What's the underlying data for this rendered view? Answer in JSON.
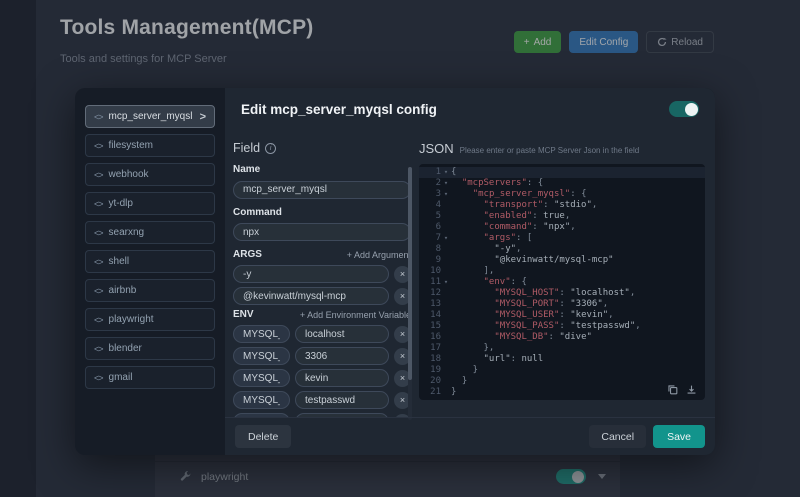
{
  "page": {
    "title": "Tools Management(MCP)",
    "subtitle": "Tools and settings for MCP Server",
    "actions": {
      "add": "Add",
      "edit_config": "Edit Config",
      "reload": "Reload"
    }
  },
  "background_tool_row": {
    "name": "playwright",
    "enabled": true
  },
  "modal": {
    "server_list": [
      {
        "label": "mcp_server_myqsl",
        "selected": true
      },
      {
        "label": "filesystem",
        "selected": false
      },
      {
        "label": "webhook",
        "selected": false
      },
      {
        "label": "yt-dlp",
        "selected": false
      },
      {
        "label": "searxng",
        "selected": false
      },
      {
        "label": "shell",
        "selected": false
      },
      {
        "label": "airbnb",
        "selected": false
      },
      {
        "label": "playwright",
        "selected": false
      },
      {
        "label": "blender",
        "selected": false
      },
      {
        "label": "gmail",
        "selected": false
      }
    ],
    "header": {
      "title": "Edit mcp_server_myqsl config",
      "enabled": true
    },
    "field_panel": {
      "title": "Field",
      "name_label": "Name",
      "name_value": "mcp_server_myqsl",
      "command_label": "Command",
      "command_value": "npx",
      "args_label": "ARGS",
      "add_argument_label": "+ Add Argument",
      "args": [
        "-y",
        "@kevinwatt/mysql-mcp"
      ],
      "env_label": "ENV",
      "add_env_label": "+ Add Environment Variable",
      "env": [
        {
          "key": "MYSQL_HOST",
          "value": "localhost"
        },
        {
          "key": "MYSQL_PORT",
          "value": "3306"
        },
        {
          "key": "MYSQL_USER",
          "value": "kevin"
        },
        {
          "key": "MYSQL_PASS",
          "value": "testpasswd"
        },
        {
          "key": "MYSQL_DB",
          "value": "dive"
        }
      ]
    },
    "json_panel": {
      "title": "JSON",
      "hint": "Please enter or paste MCP Server Json in the field",
      "code_lines": [
        {
          "n": 1,
          "fold": true,
          "parts": [
            [
              "{",
              "pln"
            ]
          ]
        },
        {
          "n": 2,
          "fold": true,
          "parts": [
            [
              "  ",
              "pln"
            ],
            [
              "\"mcpServers\"",
              "key"
            ],
            [
              ": {",
              "pln"
            ]
          ]
        },
        {
          "n": 3,
          "fold": true,
          "parts": [
            [
              "    ",
              "pln"
            ],
            [
              "\"mcp_server_myqsl\"",
              "key"
            ],
            [
              ": {",
              "pln"
            ]
          ]
        },
        {
          "n": 4,
          "fold": false,
          "parts": [
            [
              "      ",
              "pln"
            ],
            [
              "\"transport\"",
              "key"
            ],
            [
              ": ",
              "pln"
            ],
            [
              "\"stdio\"",
              "str"
            ],
            [
              ",",
              "pln"
            ]
          ]
        },
        {
          "n": 5,
          "fold": false,
          "parts": [
            [
              "      ",
              "pln"
            ],
            [
              "\"enabled\"",
              "key"
            ],
            [
              ": ",
              "pln"
            ],
            [
              "true",
              "kw"
            ],
            [
              ",",
              "pln"
            ]
          ]
        },
        {
          "n": 6,
          "fold": false,
          "parts": [
            [
              "      ",
              "pln"
            ],
            [
              "\"command\"",
              "key"
            ],
            [
              ": ",
              "pln"
            ],
            [
              "\"npx\"",
              "str"
            ],
            [
              ",",
              "pln"
            ]
          ]
        },
        {
          "n": 7,
          "fold": true,
          "parts": [
            [
              "      ",
              "pln"
            ],
            [
              "\"args\"",
              "key"
            ],
            [
              ": [",
              "pln"
            ]
          ]
        },
        {
          "n": 8,
          "fold": false,
          "parts": [
            [
              "        ",
              "pln"
            ],
            [
              "\"-y\"",
              "str"
            ],
            [
              ",",
              "pln"
            ]
          ]
        },
        {
          "n": 9,
          "fold": false,
          "parts": [
            [
              "        ",
              "pln"
            ],
            [
              "\"@kevinwatt/mysql-mcp\"",
              "str"
            ]
          ]
        },
        {
          "n": 10,
          "fold": false,
          "parts": [
            [
              "      ],",
              "pln"
            ]
          ]
        },
        {
          "n": 11,
          "fold": true,
          "parts": [
            [
              "      ",
              "pln"
            ],
            [
              "\"env\"",
              "key"
            ],
            [
              ": {",
              "pln"
            ]
          ]
        },
        {
          "n": 12,
          "fold": false,
          "parts": [
            [
              "        ",
              "pln"
            ],
            [
              "\"MYSQL_HOST\"",
              "key"
            ],
            [
              ": ",
              "pln"
            ],
            [
              "\"localhost\"",
              "str"
            ],
            [
              ",",
              "pln"
            ]
          ]
        },
        {
          "n": 13,
          "fold": false,
          "parts": [
            [
              "        ",
              "pln"
            ],
            [
              "\"MYSQL_PORT\"",
              "key"
            ],
            [
              ": ",
              "pln"
            ],
            [
              "\"3306\"",
              "str"
            ],
            [
              ",",
              "pln"
            ]
          ]
        },
        {
          "n": 14,
          "fold": false,
          "parts": [
            [
              "        ",
              "pln"
            ],
            [
              "\"MYSQL_USER\"",
              "key"
            ],
            [
              ": ",
              "pln"
            ],
            [
              "\"kevin\"",
              "str"
            ],
            [
              ",",
              "pln"
            ]
          ]
        },
        {
          "n": 15,
          "fold": false,
          "parts": [
            [
              "        ",
              "pln"
            ],
            [
              "\"MYSQL_PASS\"",
              "key"
            ],
            [
              ": ",
              "pln"
            ],
            [
              "\"testpasswd\"",
              "str"
            ],
            [
              ",",
              "pln"
            ]
          ]
        },
        {
          "n": 16,
          "fold": false,
          "parts": [
            [
              "        ",
              "pln"
            ],
            [
              "\"MYSQL_DB\"",
              "key"
            ],
            [
              ": ",
              "pln"
            ],
            [
              "\"dive\"",
              "str"
            ]
          ]
        },
        {
          "n": 17,
          "fold": false,
          "parts": [
            [
              "      },",
              "pln"
            ]
          ]
        },
        {
          "n": 18,
          "fold": false,
          "parts": [
            [
              "      ",
              "pln"
            ],
            [
              "\"url\"",
              "str"
            ],
            [
              ": ",
              "pln"
            ],
            [
              "null",
              "kw"
            ]
          ]
        },
        {
          "n": 19,
          "fold": false,
          "parts": [
            [
              "    }",
              "pln"
            ]
          ]
        },
        {
          "n": 20,
          "fold": false,
          "parts": [
            [
              "  }",
              "pln"
            ]
          ]
        },
        {
          "n": 21,
          "fold": false,
          "parts": [
            [
              "}",
              "pln"
            ]
          ]
        }
      ]
    },
    "footer": {
      "delete": "Delete",
      "cancel": "Cancel",
      "save": "Save"
    }
  },
  "colors": {
    "accent_teal": "#12948c",
    "accent_green": "#46a34d",
    "accent_blue": "#3c7fc0",
    "json_key": "#b05b66",
    "json_string": "#a6afb8"
  }
}
